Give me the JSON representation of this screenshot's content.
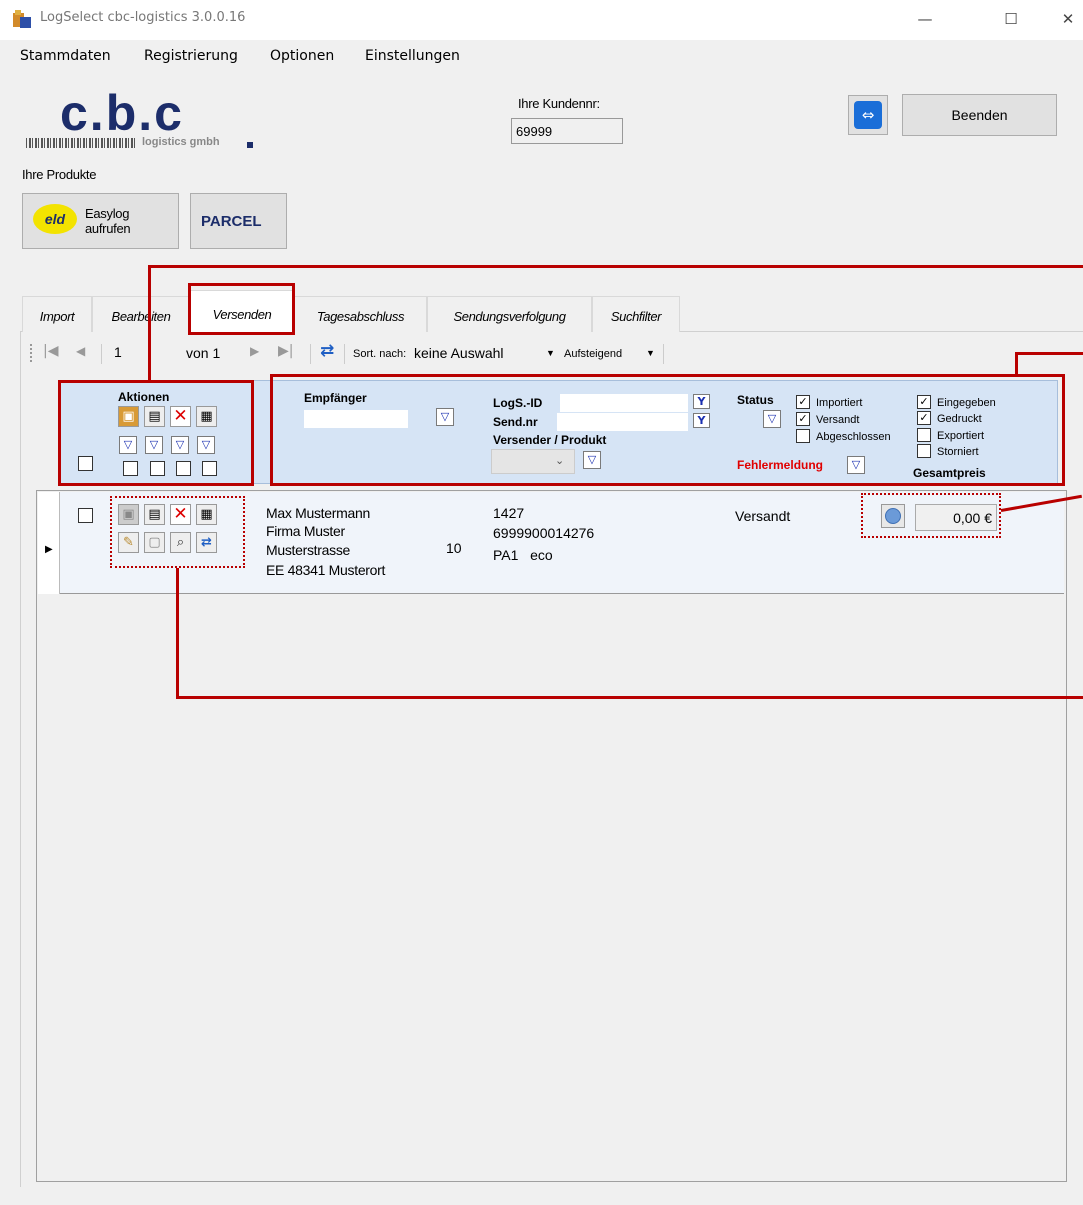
{
  "window": {
    "title": "LogSelect cbc-logistics 3.0.0.16",
    "minimize": "—",
    "maximize": "☐",
    "close": "✕"
  },
  "menu": [
    "Stammdaten",
    "Registrierung",
    "Optionen",
    "Einstellungen"
  ],
  "logo": {
    "main": "c.b.c",
    "sub": "logistics gmbh"
  },
  "customer": {
    "label": "Ihre Kundennr:",
    "value": "69999"
  },
  "products": {
    "label": "Ihre Produkte",
    "easylog_label": "Easylog aufrufen",
    "parcel_label": "PARCEL"
  },
  "exit_label": "Beenden",
  "tabs": [
    "Import",
    "Bearbeiten",
    "Versenden",
    "Tagesabschluss",
    "Sendungsverfolgung",
    "Suchfilter"
  ],
  "nav": {
    "page": "1",
    "of": "von 1",
    "sort_label": "Sort. nach:",
    "sort_value": "keine Auswahl",
    "order": "Aufsteigend"
  },
  "header": {
    "actions": "Aktionen",
    "recipient": "Empfänger",
    "logs_id": "LogS.-ID",
    "send_nr": "Send.nr",
    "sender_product": "Versender / Produkt",
    "status": "Status",
    "status_options": [
      {
        "label": "Importiert",
        "checked": true
      },
      {
        "label": "Versandt",
        "checked": true
      },
      {
        "label": "Abgeschlossen",
        "checked": false
      },
      {
        "label": "Eingegeben",
        "checked": true
      },
      {
        "label": "Gedruckt",
        "checked": true
      },
      {
        "label": "Exportiert",
        "checked": false
      },
      {
        "label": "Storniert",
        "checked": false
      }
    ],
    "error": "Fehlermeldung",
    "total": "Gesamtpreis"
  },
  "row": {
    "name": "Max Mustermann",
    "company": "Firma Muster",
    "street": "Musterstrasse",
    "city": "EE  48341 Musterort",
    "count": "10",
    "logs_id": "1427",
    "send_nr": "6999900014276",
    "product": "PA1   eco",
    "status": "Versandt",
    "price": "0,00 €"
  },
  "colors": {
    "accent_red": "#b80000",
    "header_blue": "#d6e4f5",
    "filter_blue": "#1a2fb0",
    "error_red": "#e00000"
  }
}
